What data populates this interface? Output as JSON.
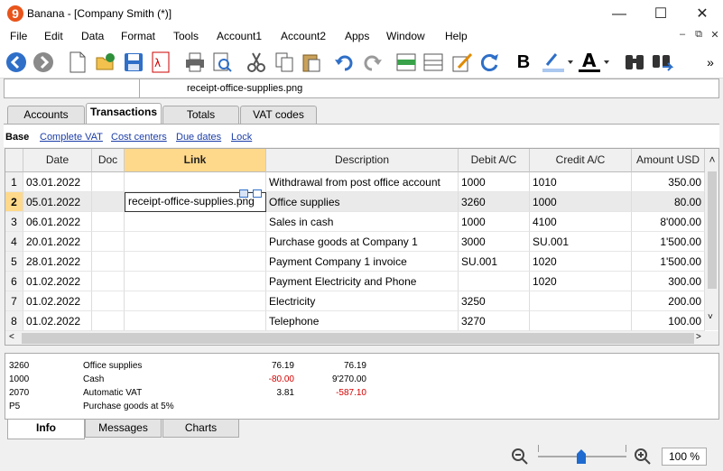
{
  "window": {
    "title": "Banana - [Company Smith (*)]",
    "app_letter": "9"
  },
  "menu": [
    "File",
    "Edit",
    "Data",
    "Format",
    "Tools",
    "Account1",
    "Account2",
    "Apps",
    "Window",
    "Help"
  ],
  "cellbar": {
    "value": "receipt-office-supplies.png"
  },
  "tabs": [
    "Accounts",
    "Transactions",
    "Totals",
    "VAT codes"
  ],
  "views": {
    "base": "Base",
    "links": [
      "Complete VAT",
      "Cost centers",
      "Due dates",
      "Lock"
    ]
  },
  "columns": [
    "Date",
    "Doc",
    "Link",
    "Description",
    "Debit A/C",
    "Credit A/C",
    "Amount USD"
  ],
  "rows": [
    {
      "n": "1",
      "date": "03.01.2022",
      "doc": "",
      "link": "",
      "desc": "Withdrawal from post office account",
      "debit": "1000",
      "credit": "1010",
      "amount": "350.00"
    },
    {
      "n": "2",
      "date": "05.01.2022",
      "doc": "",
      "link": "receipt-office-supplies.png",
      "desc": "Office supplies",
      "debit": "3260",
      "credit": "1000",
      "amount": "80.00"
    },
    {
      "n": "3",
      "date": "06.01.2022",
      "doc": "",
      "link": "",
      "desc": "Sales in cash",
      "debit": "1000",
      "credit": "4100",
      "amount": "8'000.00"
    },
    {
      "n": "4",
      "date": "20.01.2022",
      "doc": "",
      "link": "",
      "desc": "Purchase goods at Company 1",
      "debit": "3000",
      "credit": "SU.001",
      "amount": "1'500.00"
    },
    {
      "n": "5",
      "date": "28.01.2022",
      "doc": "",
      "link": "",
      "desc": "Payment Company 1 invoice",
      "debit": "SU.001",
      "credit": "1020",
      "amount": "1'500.00"
    },
    {
      "n": "6",
      "date": "01.02.2022",
      "doc": "",
      "link": "",
      "desc": "Payment Electricity and Phone",
      "debit": "",
      "credit": "1020",
      "amount": "300.00"
    },
    {
      "n": "7",
      "date": "01.02.2022",
      "doc": "",
      "link": "",
      "desc": "Electricity",
      "debit": "3250",
      "credit": "",
      "amount": "200.00"
    },
    {
      "n": "8",
      "date": "01.02.2022",
      "doc": "",
      "link": "",
      "desc": "Telephone",
      "debit": "3270",
      "credit": "",
      "amount": "100.00"
    }
  ],
  "info": [
    {
      "acc": "3260",
      "name": "Office supplies",
      "v1": "76.19",
      "v2": "76.19"
    },
    {
      "acc": "1000",
      "name": "Cash",
      "v1": "-80.00",
      "v2": "9'270.00"
    },
    {
      "acc": "2070",
      "name": "Automatic VAT",
      "v1": "3.81",
      "v2": "-587.10"
    },
    {
      "acc": "P5",
      "name": "Purchase goods at 5%",
      "v1": "",
      "v2": ""
    }
  ],
  "bottom_tabs": [
    "Info",
    "Messages",
    "Charts"
  ],
  "zoom": "100 %",
  "colors": {
    "selected_header": "#ffd98b",
    "link": "#1c3ea8",
    "negative": "#d40000"
  }
}
